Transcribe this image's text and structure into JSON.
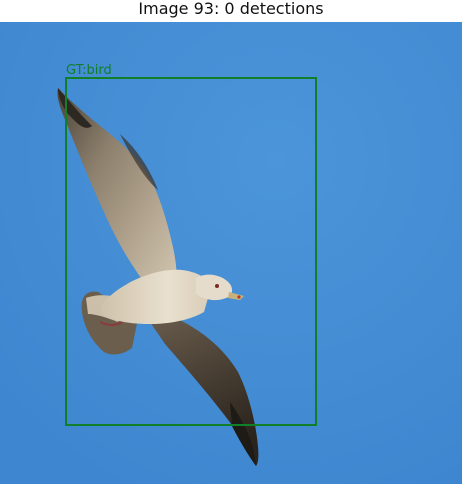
{
  "title": "Image 93: 0 detections",
  "photo": {
    "subject_icon": "bird-icon",
    "sky_color": "#4a90d6"
  },
  "ground_truth": {
    "label": "GT:bird",
    "color": "#0f7f2a"
  }
}
